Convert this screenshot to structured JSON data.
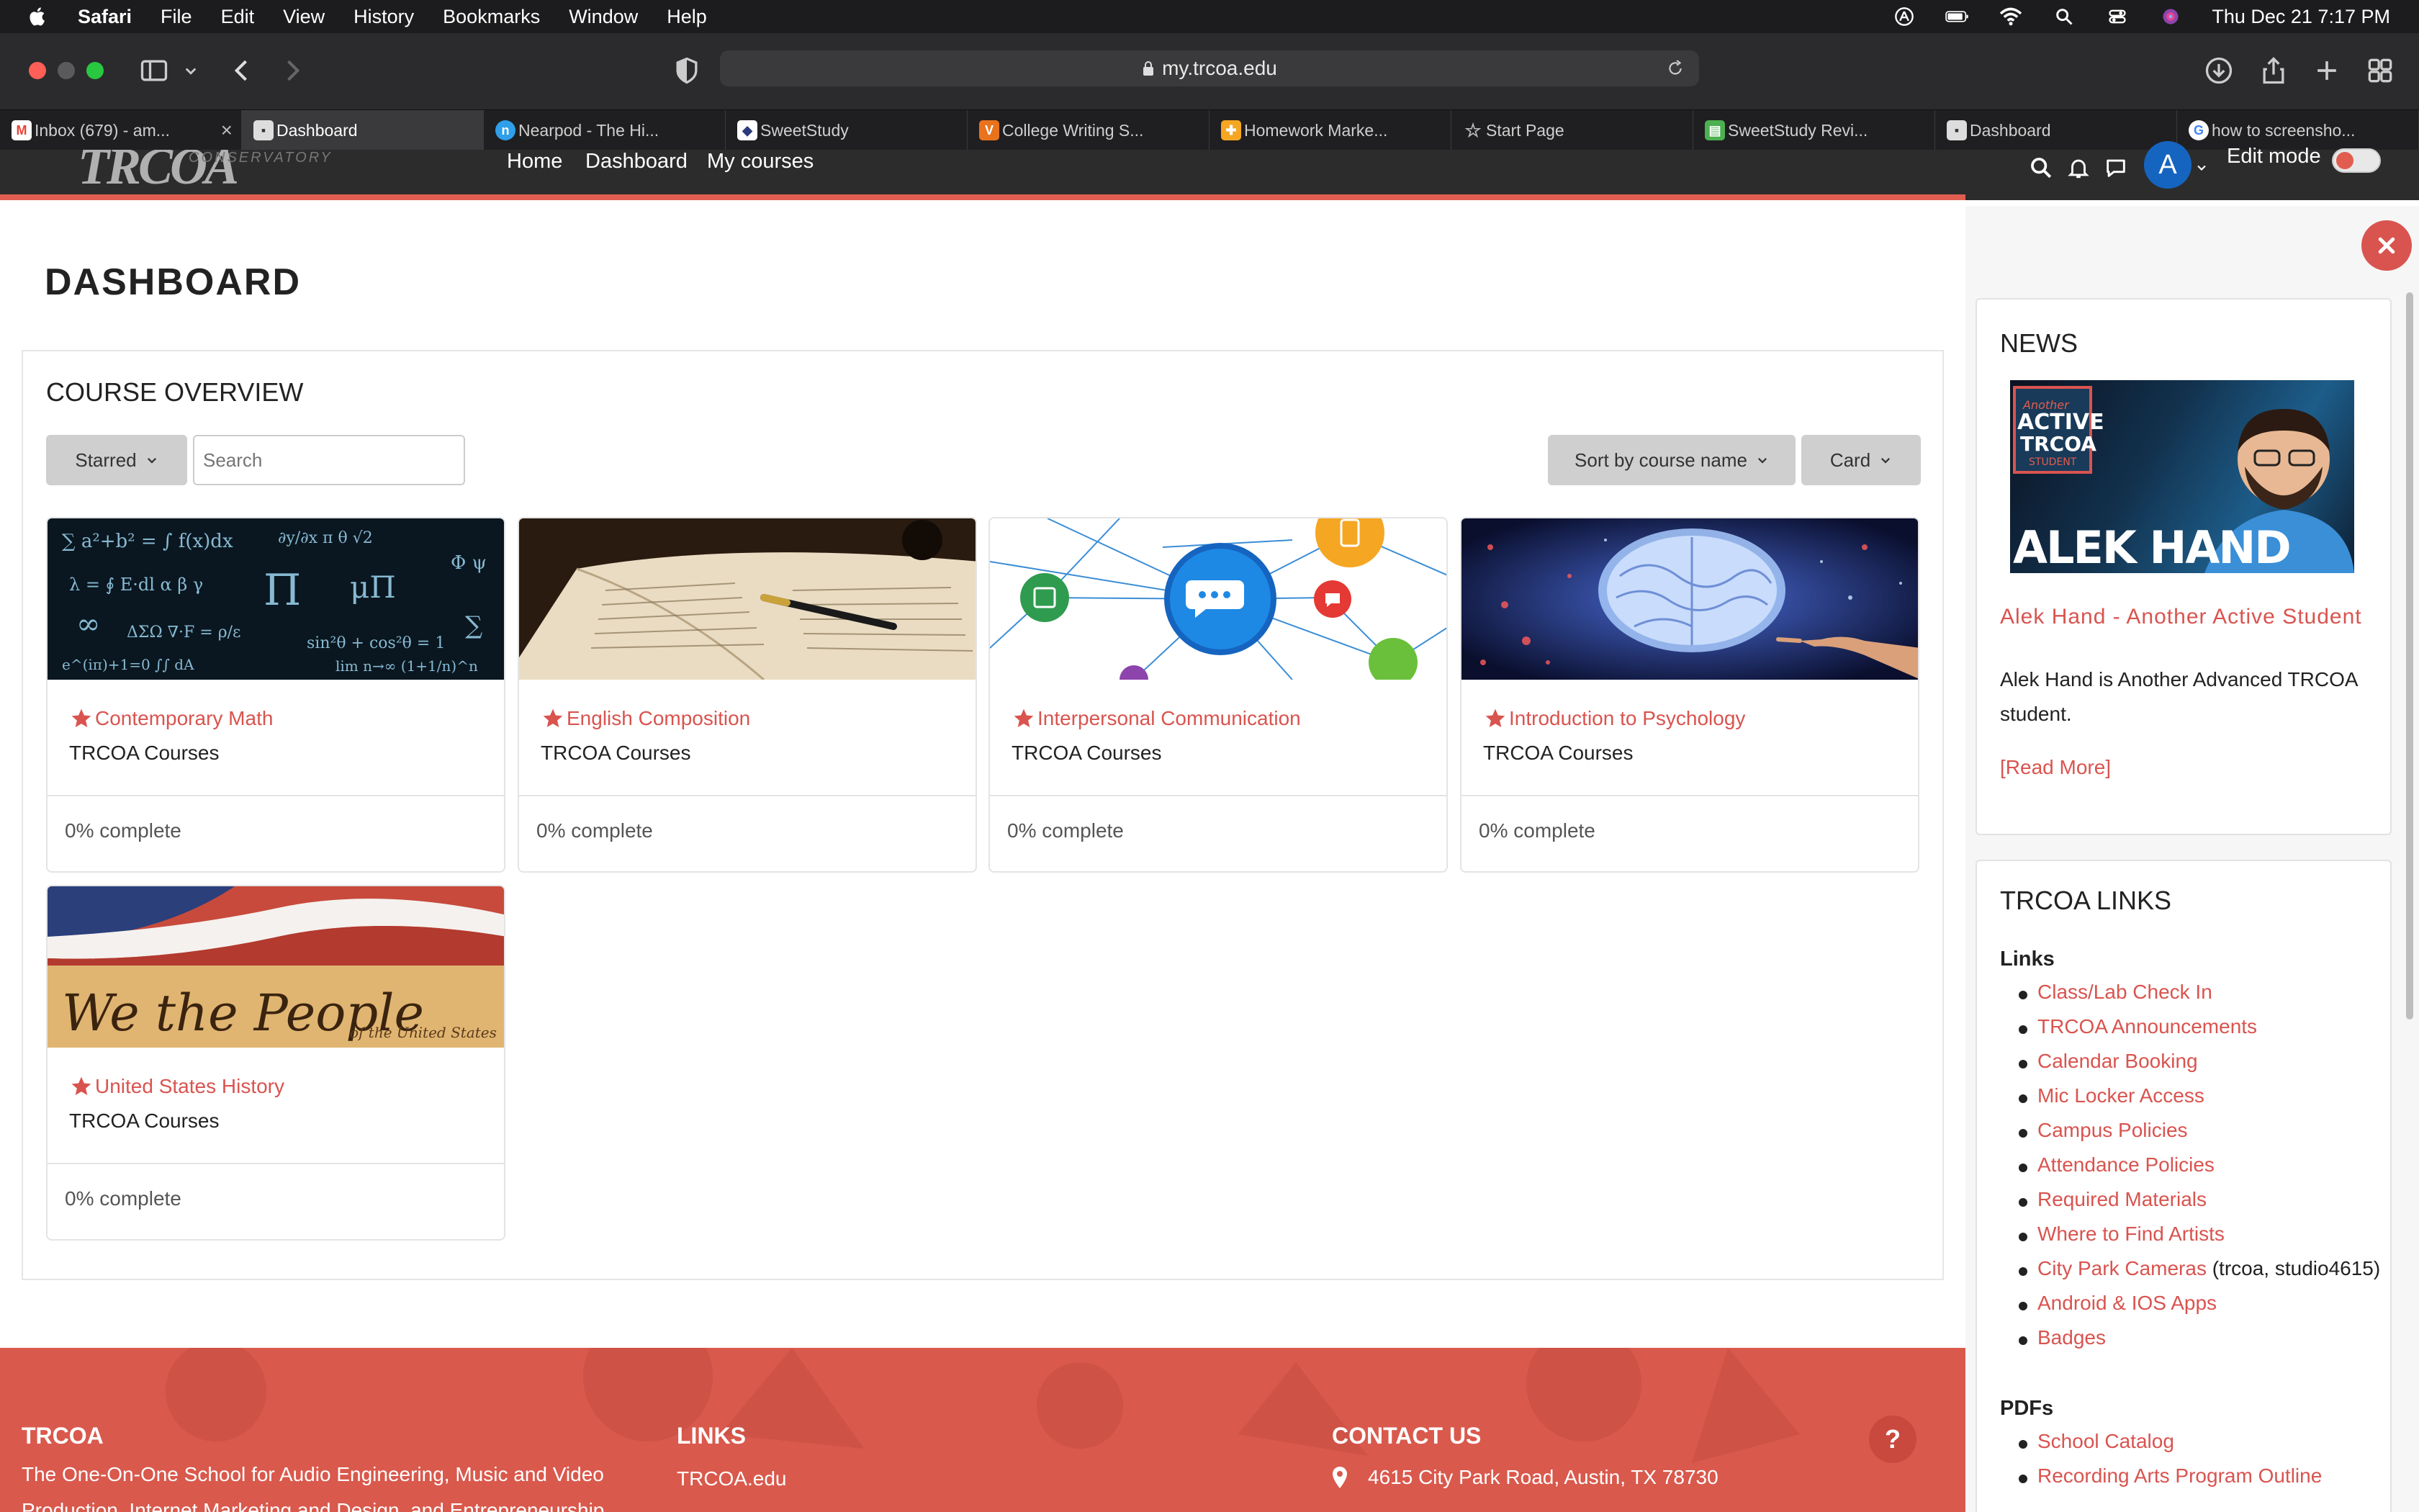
{
  "menubar": {
    "app": "Safari",
    "items": [
      "File",
      "Edit",
      "View",
      "History",
      "Bookmarks",
      "Window",
      "Help"
    ],
    "datetime": "Thu Dec 21  7:17 PM"
  },
  "browser": {
    "url": "my.trcoa.edu",
    "tabs": [
      {
        "label": "Inbox (679) - am...",
        "icon": "gmail-icon",
        "active": false
      },
      {
        "label": "Dashboard",
        "icon": "moodle-icon",
        "active": true
      },
      {
        "label": "Nearpod - The Hi...",
        "icon": "nearpod-icon",
        "active": false
      },
      {
        "label": "SweetStudy",
        "icon": "sweetstudy-icon",
        "active": false
      },
      {
        "label": "College Writing S...",
        "icon": "v-icon",
        "active": false
      },
      {
        "label": "Homework Marke...",
        "icon": "homework-icon",
        "active": false
      },
      {
        "label": "Start Page",
        "icon": "star-icon",
        "active": false
      },
      {
        "label": "SweetStudy Revi...",
        "icon": "sweetstudy-review-icon",
        "active": false
      },
      {
        "label": "Dashboard",
        "icon": "moodle-icon",
        "active": false
      },
      {
        "label": "how to screensho...",
        "icon": "google-icon",
        "active": false
      }
    ]
  },
  "site": {
    "logo": "TRCOA",
    "logo_sub": "CONSERVATORY",
    "nav": [
      "Home",
      "Dashboard",
      "My courses"
    ],
    "avatar_initial": "A",
    "edit_mode_label": "Edit mode"
  },
  "main": {
    "title": "DASHBOARD",
    "overview_title": "COURSE OVERVIEW",
    "filter_label": "Starred",
    "search_placeholder": "Search",
    "sort_label": "Sort by course name",
    "view_label": "Card",
    "courses": [
      {
        "name": "Contemporary Math",
        "category": "TRCOA Courses",
        "progress": "0% complete"
      },
      {
        "name": "English Composition",
        "category": "TRCOA Courses",
        "progress": "0% complete"
      },
      {
        "name": "Interpersonal Communication",
        "category": "TRCOA Courses",
        "progress": "0% complete"
      },
      {
        "name": "Introduction to Psychology",
        "category": "TRCOA Courses",
        "progress": "0% complete"
      },
      {
        "name": "United States History",
        "category": "TRCOA Courses",
        "progress": "0% complete"
      }
    ]
  },
  "drawer": {
    "news": {
      "title": "NEWS",
      "image_caption": "ALEK HAND",
      "image_badge": [
        "Another",
        "ACTIVE",
        "TRCOA",
        "STUDENT"
      ],
      "headline": "Alek Hand - Another Active Student",
      "text": "Alek Hand is Another Advanced TRCOA student.",
      "read_more": "[Read More]"
    },
    "links_block": {
      "title": "TRCOA LINKS",
      "links_heading": "Links",
      "links": [
        "Class/Lab Check In",
        "TRCOA Announcements",
        "Calendar Booking",
        "Mic Locker Access",
        "Campus Policies",
        "Attendance Policies",
        "Required Materials",
        "Where to Find Artists",
        "City Park Cameras",
        "Android & IOS Apps",
        "Badges"
      ],
      "city_park_note": "(trcoa, studio4615)",
      "pdfs_heading": "PDFs",
      "pdfs": [
        "School Catalog",
        "Recording Arts Program Outline"
      ]
    }
  },
  "footer": {
    "col1_title": "TRCOA",
    "col1_text": "The One-On-One School for Audio Engineering, Music and Video",
    "col1_text2": "Production, Internet Marketing and Design, and Entrepreneurship",
    "col2_title": "LINKS",
    "col2_link": "TRCOA.edu",
    "col3_title": "CONTACT US",
    "address": "4615 City Park Road, Austin, TX 78730",
    "help": "?"
  },
  "colors": {
    "accent": "#d9534f",
    "navbar": "#2c2c2c",
    "footer": "#d9594d"
  }
}
